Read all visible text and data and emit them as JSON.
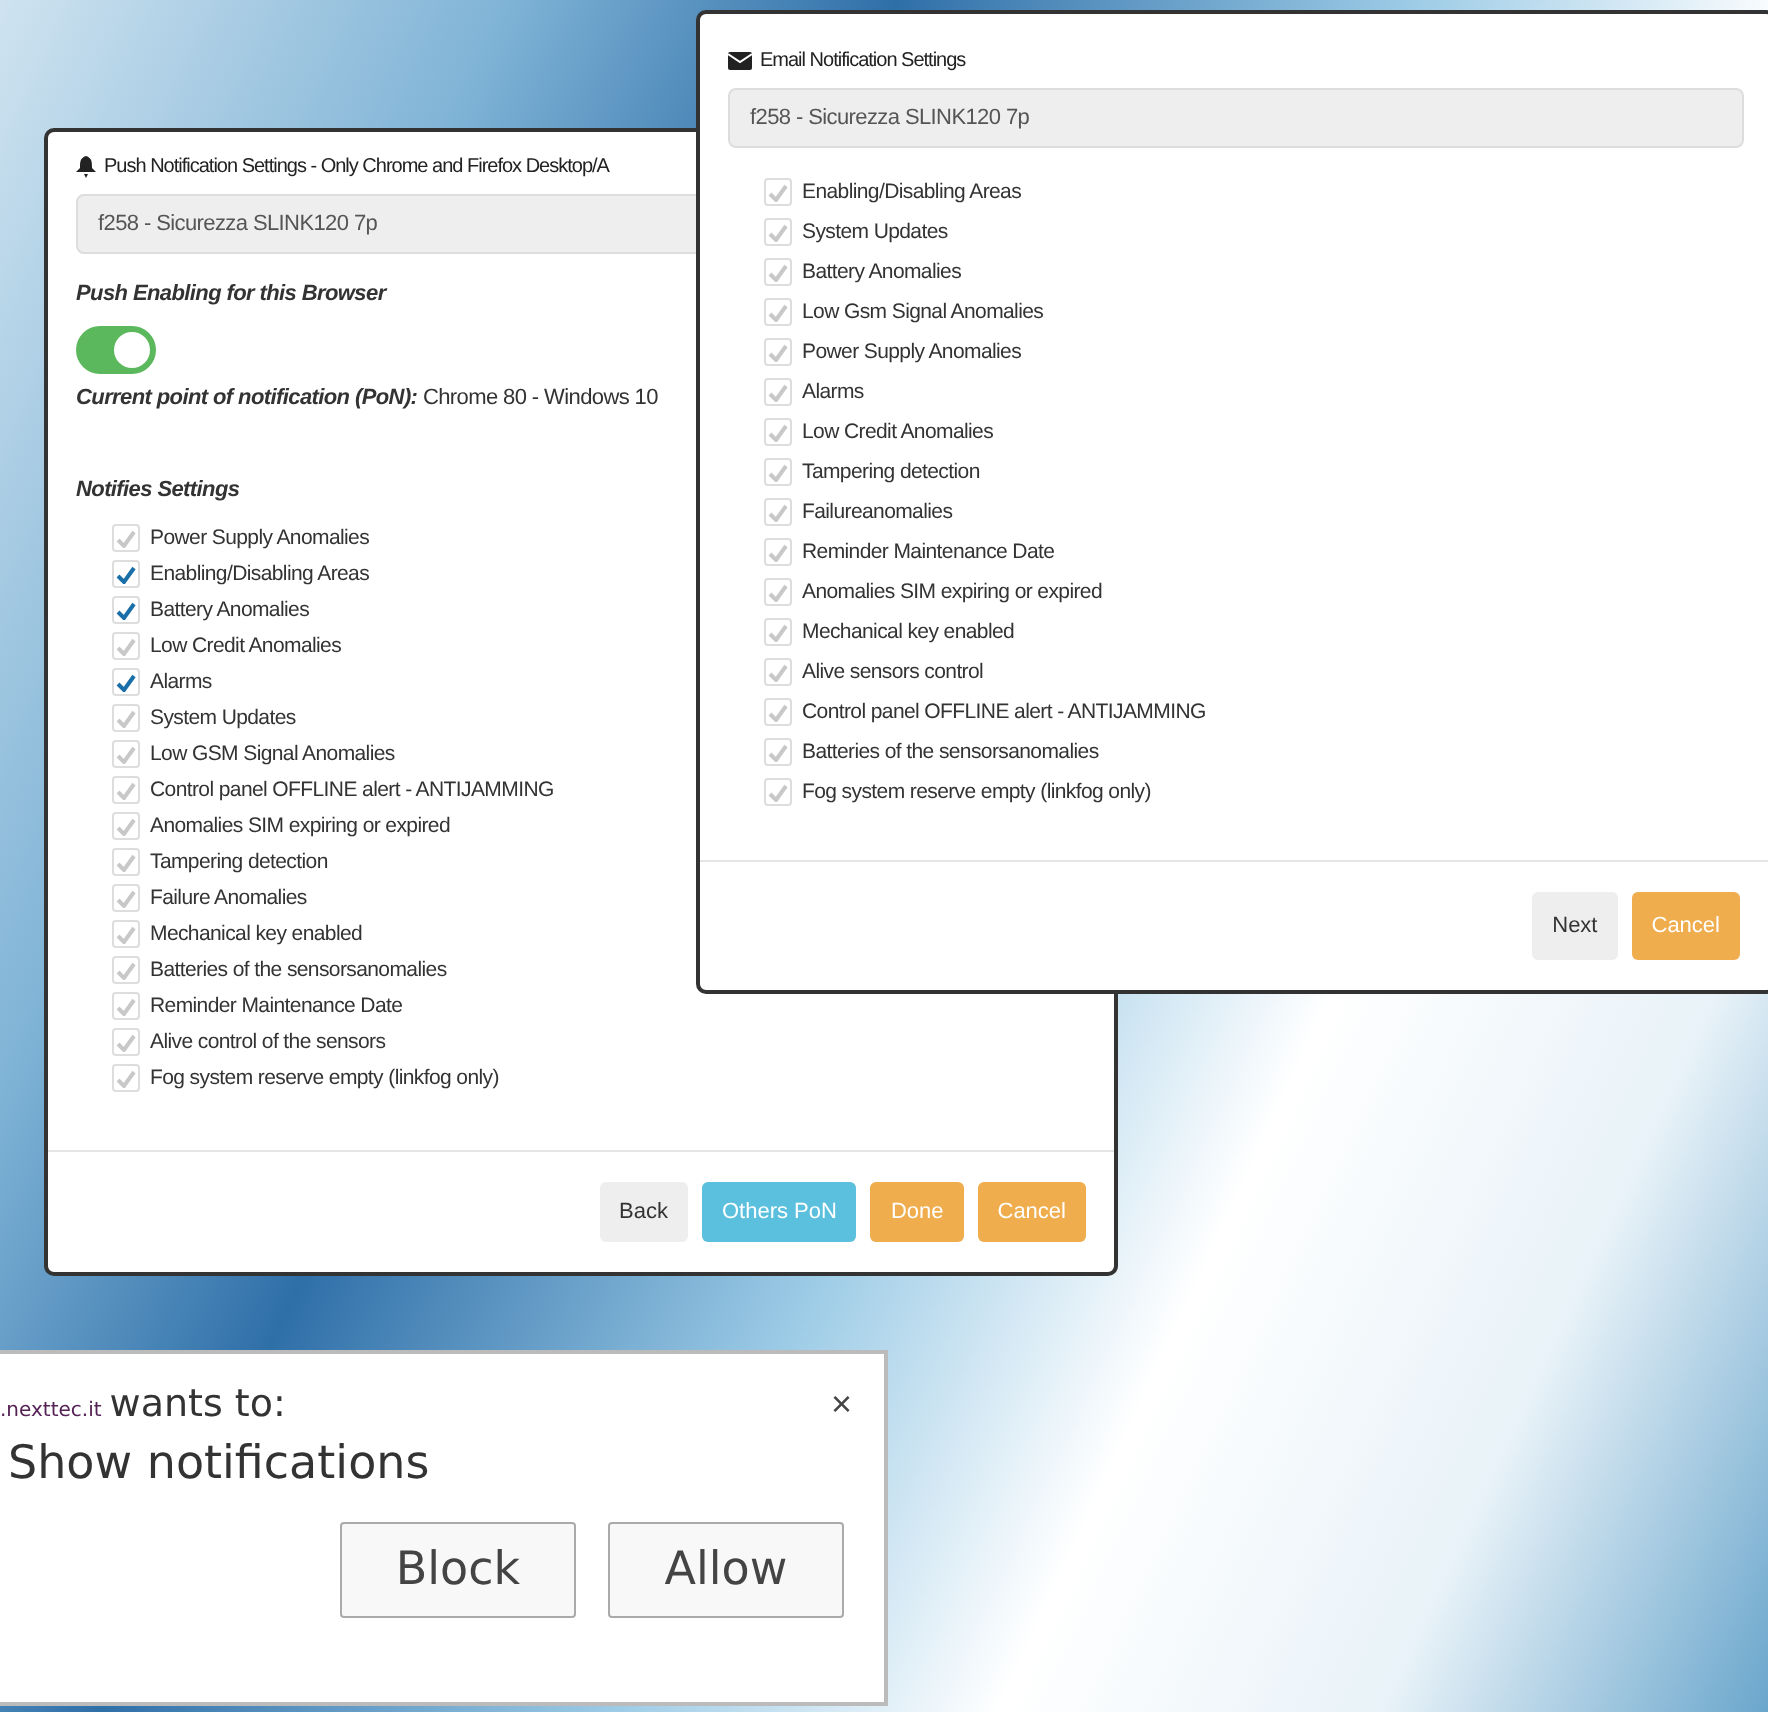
{
  "push_dialog": {
    "title": "Push Notification Settings - Only Chrome and Firefox Desktop/A",
    "device": "f258 - Sicurezza SLINK120 7p",
    "enable_label": "Push Enabling for this Browser",
    "push_enabled": {
      "on": true
    },
    "current_pon_label": "Current point of notification (PoN):",
    "current_pon_value": "Chrome 80 - Windows 10",
    "settings_heading": "Notifies Settings",
    "items": [
      {
        "label": "Power Supply Anomalies",
        "checked": false
      },
      {
        "label": "Enabling/Disabling Areas",
        "checked": true
      },
      {
        "label": "Battery Anomalies",
        "checked": true
      },
      {
        "label": "Low Credit Anomalies",
        "checked": false
      },
      {
        "label": "Alarms",
        "checked": true
      },
      {
        "label": "System Updates",
        "checked": false
      },
      {
        "label": "Low GSM Signal Anomalies",
        "checked": false
      },
      {
        "label": "Control panel OFFLINE alert - ANTIJAMMING",
        "checked": false
      },
      {
        "label": "Anomalies SIM expiring or expired",
        "checked": false
      },
      {
        "label": "Tampering detection",
        "checked": false
      },
      {
        "label": "Failure Anomalies",
        "checked": false
      },
      {
        "label": "Mechanical key enabled",
        "checked": false
      },
      {
        "label": "Batteries of the sensorsanomalies",
        "checked": false
      },
      {
        "label": "Reminder Maintenance Date",
        "checked": false
      },
      {
        "label": "Alive control of the sensors",
        "checked": false
      },
      {
        "label": "Fog system reserve empty (linkfog only)",
        "checked": false
      }
    ],
    "buttons": [
      {
        "label": "Back",
        "kind": "default"
      },
      {
        "label": "Others PoN",
        "kind": "info"
      },
      {
        "label": "Done",
        "kind": "warning"
      },
      {
        "label": "Cancel",
        "kind": "warning"
      }
    ]
  },
  "email_dialog": {
    "title": "Email Notification Settings",
    "device": "f258 - Sicurezza SLINK120 7p",
    "items": [
      {
        "label": "Enabling/Disabling Areas",
        "checked": false
      },
      {
        "label": "System Updates",
        "checked": false
      },
      {
        "label": "Battery Anomalies",
        "checked": false
      },
      {
        "label": "Low Gsm Signal Anomalies",
        "checked": false
      },
      {
        "label": "Power Supply Anomalies",
        "checked": false
      },
      {
        "label": "Alarms",
        "checked": false
      },
      {
        "label": "Low Credit Anomalies",
        "checked": false
      },
      {
        "label": "Tampering detection",
        "checked": false
      },
      {
        "label": "Failureanomalies",
        "checked": false
      },
      {
        "label": "Reminder Maintenance Date",
        "checked": false
      },
      {
        "label": "Anomalies SIM expiring or expired",
        "checked": false
      },
      {
        "label": "Mechanical key enabled",
        "checked": false
      },
      {
        "label": "Alive sensors control",
        "checked": false
      },
      {
        "label": "Control panel OFFLINE alert - ANTIJAMMING",
        "checked": false
      },
      {
        "label": "Batteries of the sensorsanomalies",
        "checked": false
      },
      {
        "label": "Fog system reserve empty (linkfog only)",
        "checked": false
      }
    ],
    "buttons": [
      {
        "label": "Next",
        "kind": "default"
      },
      {
        "label": "Cancel",
        "kind": "warning"
      }
    ]
  },
  "permission_popup": {
    "site": ".nexttec.it",
    "wants": "wants to:",
    "request": "Show notifications",
    "close": "×",
    "buttons": [
      {
        "label": "Block"
      },
      {
        "label": "Allow"
      }
    ]
  }
}
